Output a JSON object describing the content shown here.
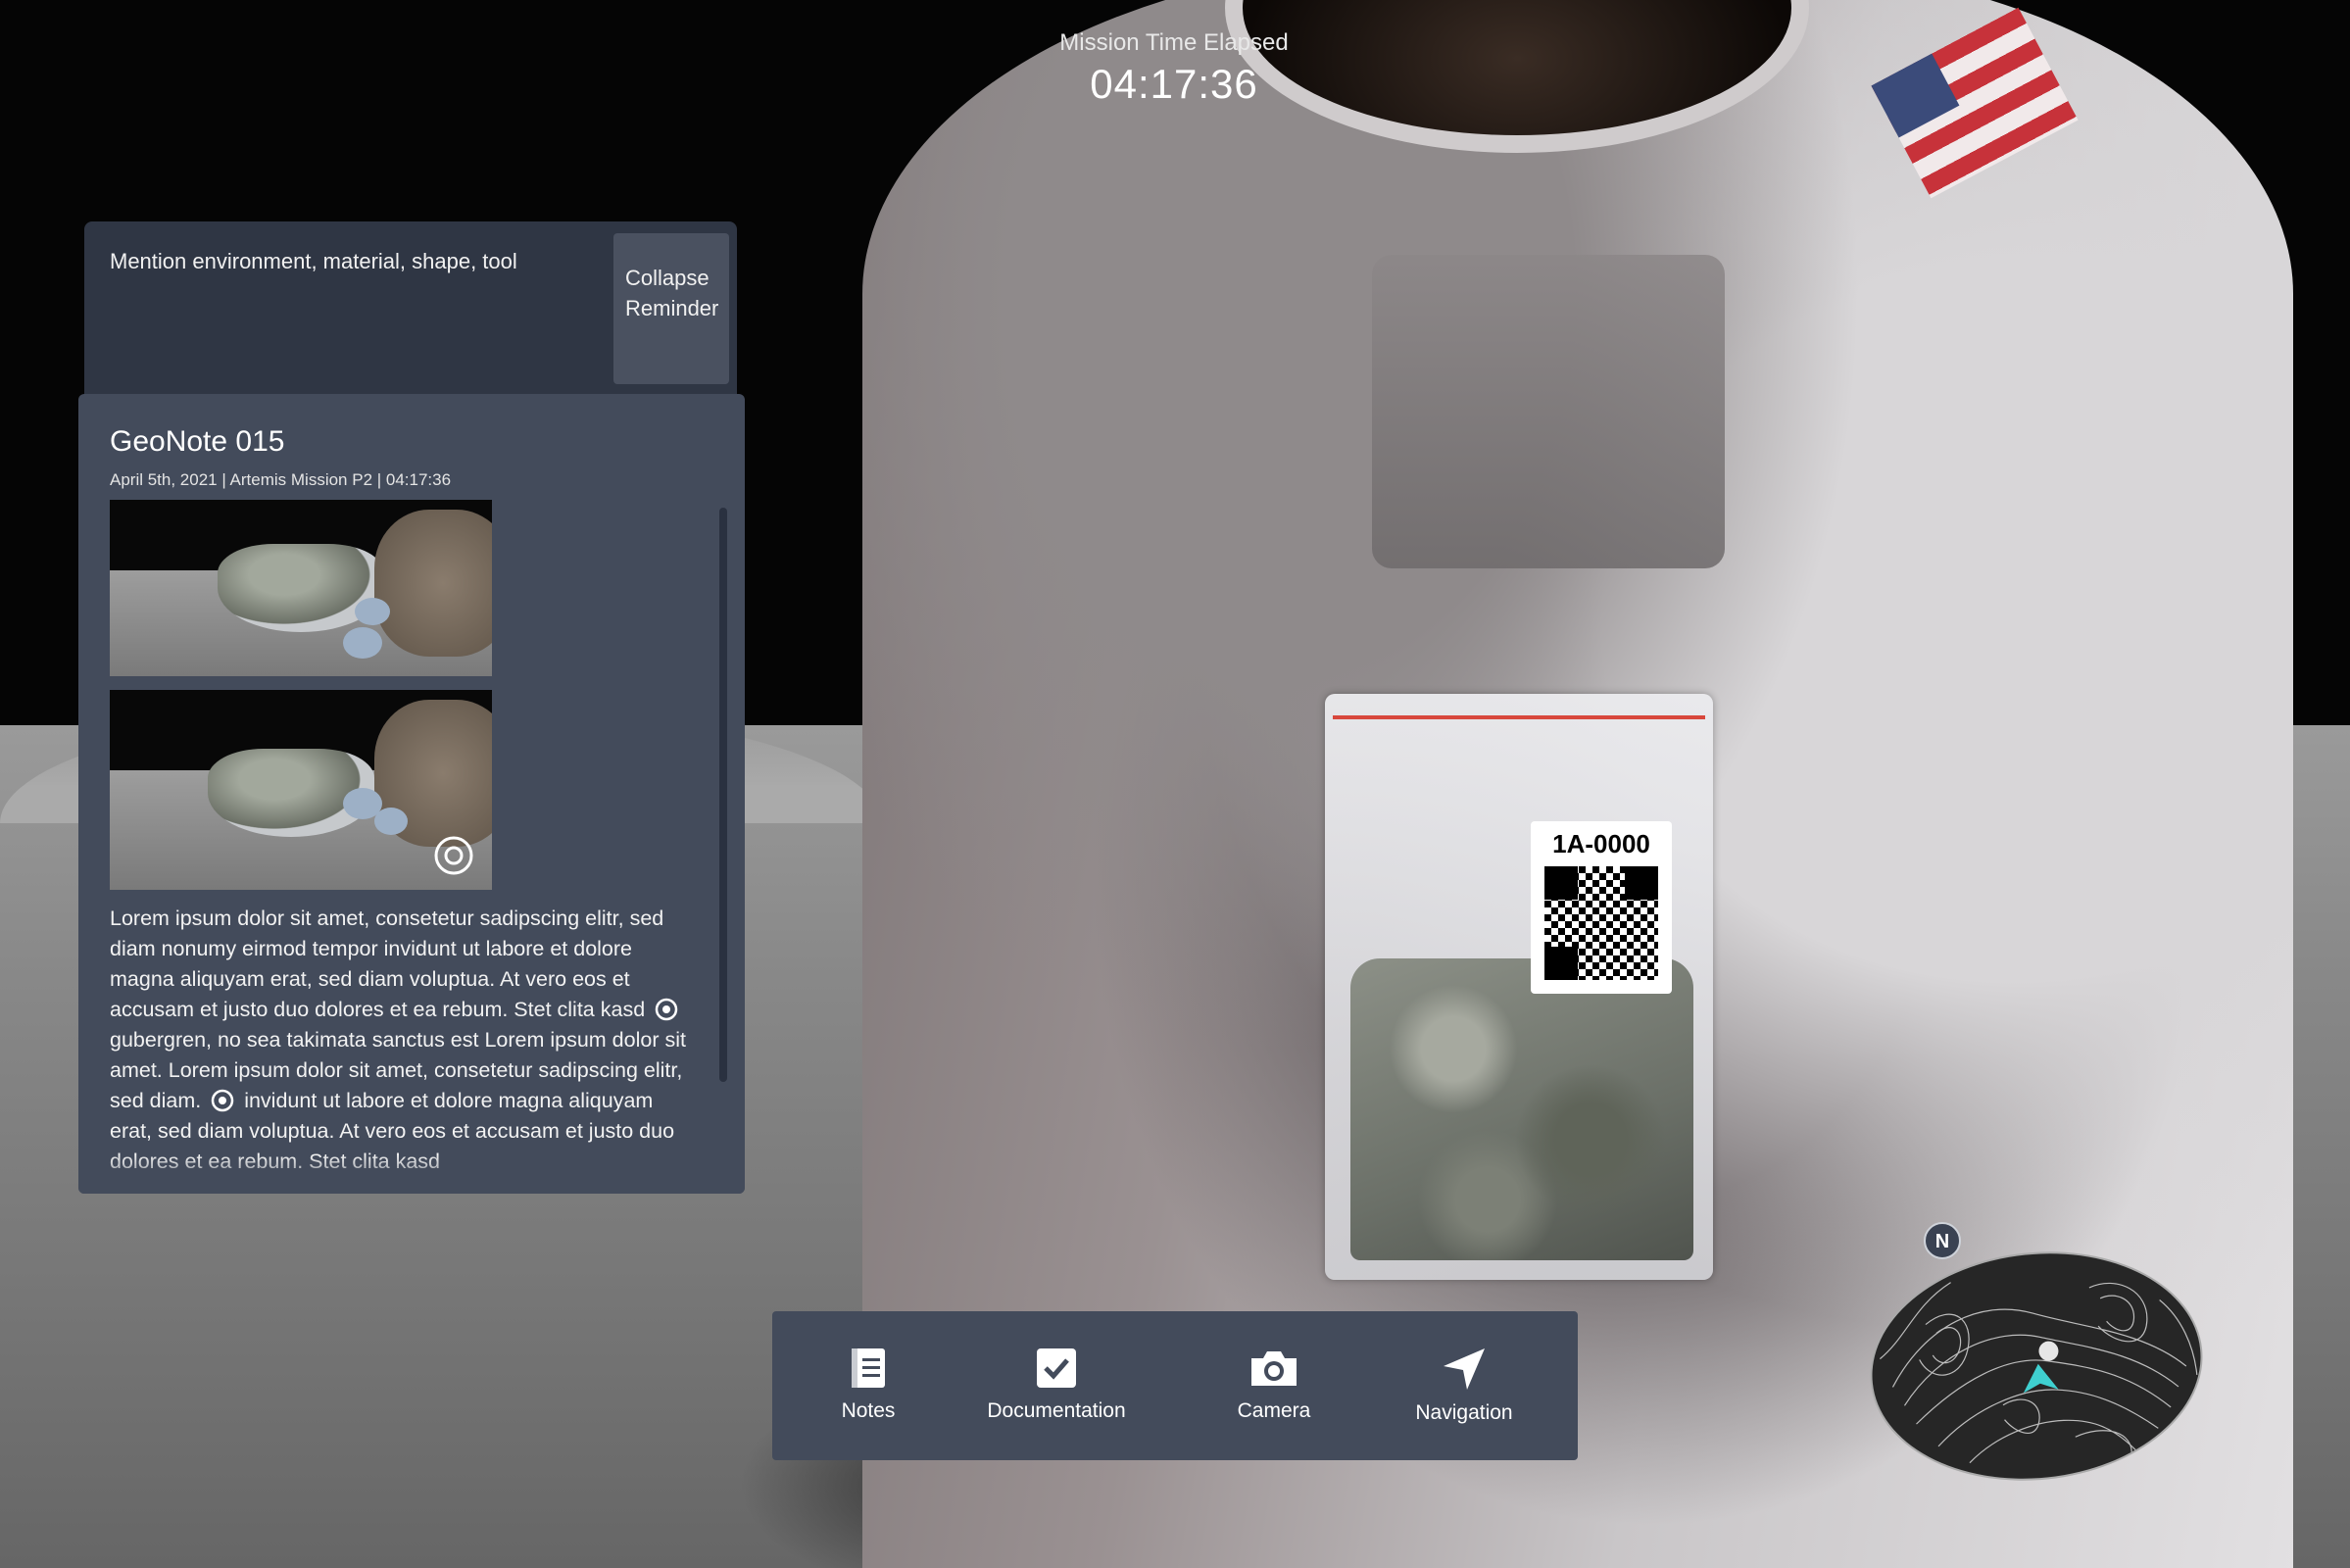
{
  "timer": {
    "label": "Mission Time Elapsed",
    "value": "04:17:36"
  },
  "reminder": {
    "text": "Mention environment, material, shape, tool",
    "collapse_label_line1": "Collapse",
    "collapse_label_line2": "Reminder"
  },
  "geonote": {
    "title": "GeoNote 015",
    "meta": "April 5th, 2021 | Artemis Mission P2 | 04:17:36",
    "body_part1": "Lorem ipsum dolor sit amet, consetetur sadipscing elitr, sed diam nonumy eirmod tempor invidunt ut labore et dolore magna aliquyam erat, sed diam voluptua. At vero eos et accusam et justo duo dolores et ea rebum. Stet clita kasd",
    "body_part2": "gubergren, no sea takimata sanctus est Lorem ipsum dolor sit amet. Lorem ipsum dolor sit amet, consetetur sadipscing elitr, sed diam.",
    "body_part3": "invidunt ut labore et dolore magna aliquyam erat, sed diam voluptua. At vero eos et accusam et justo duo dolores et ea rebum. Stet clita kasd"
  },
  "sample_bag": {
    "label": "1A-0000"
  },
  "toolbar": {
    "items": [
      {
        "label": "Notes",
        "icon": "notes-icon"
      },
      {
        "label": "Documentation",
        "icon": "checkbox-icon"
      },
      {
        "label": "Camera",
        "icon": "camera-icon"
      },
      {
        "label": "Navigation",
        "icon": "navigation-arrow-icon"
      }
    ]
  },
  "minimap": {
    "compass_label": "N",
    "marker_color": "#3fd0d0"
  }
}
